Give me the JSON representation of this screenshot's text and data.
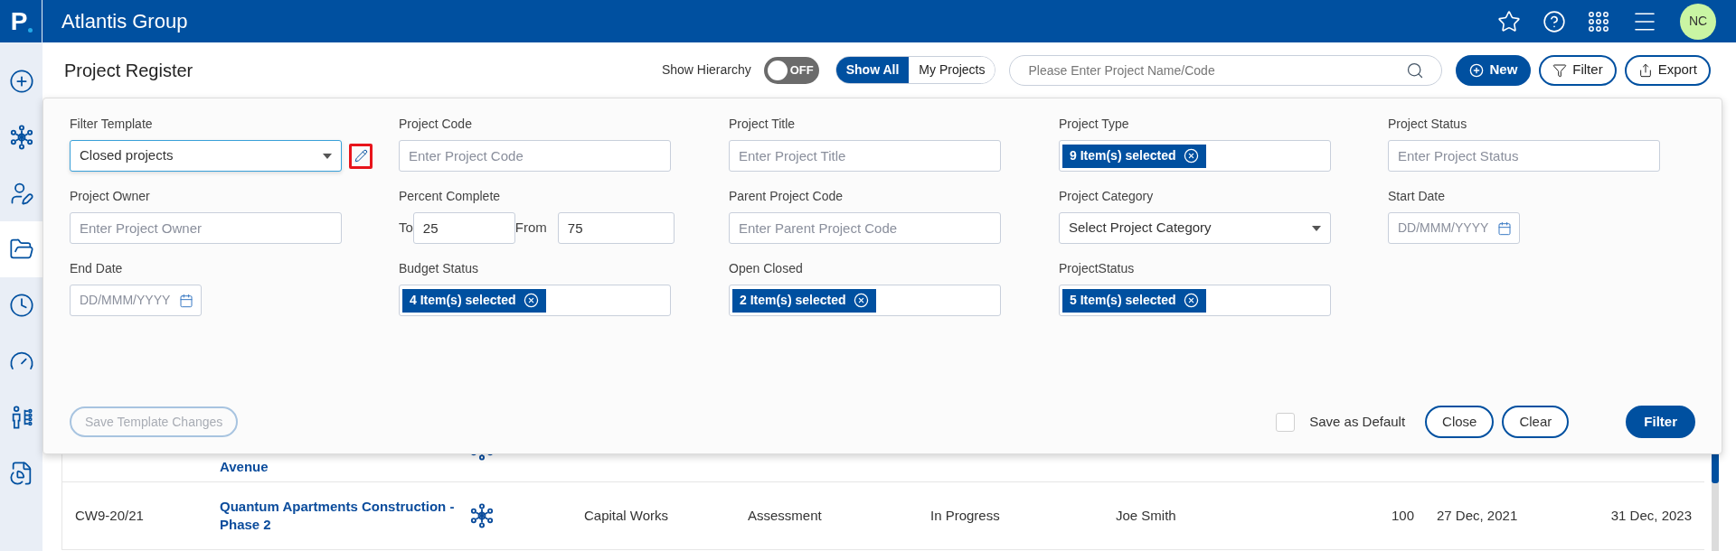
{
  "app_header": {
    "logo_text": "P",
    "company": "Atlantis Group",
    "avatar_initials": "NC"
  },
  "sidebar": {
    "items": [
      {
        "kind": "add",
        "selected": false
      },
      {
        "kind": "hub",
        "selected": false
      },
      {
        "kind": "user",
        "selected": false
      },
      {
        "kind": "folder",
        "selected": true
      },
      {
        "kind": "clock",
        "selected": false
      },
      {
        "kind": "gauge",
        "selected": false
      },
      {
        "kind": "org",
        "selected": false
      },
      {
        "kind": "report",
        "selected": false
      }
    ]
  },
  "page": {
    "title": "Project Register",
    "hierarchy": {
      "label": "Show Hierarchy",
      "on": false,
      "state_text": "OFF"
    },
    "view_tabs": [
      {
        "label": "Show All",
        "selected": true
      },
      {
        "label": "My Projects",
        "selected": false
      }
    ],
    "search": {
      "placeholder": "Please Enter Project Name/Code"
    },
    "buttons": [
      {
        "kind": "new",
        "label": "New"
      },
      {
        "kind": "filter",
        "label": "Filter"
      },
      {
        "kind": "export",
        "label": "Export"
      }
    ]
  },
  "filter_panel": {
    "fields": [
      {
        "kind": "template",
        "label": "Filter Template",
        "value": "Closed projects",
        "edit_highlighted": true
      },
      {
        "kind": "text",
        "label": "Project Code",
        "placeholder": "Enter Project Code"
      },
      {
        "kind": "text",
        "label": "Project Title",
        "placeholder": "Enter Project Title"
      },
      {
        "kind": "tags",
        "label": "Project Type",
        "tag": "9 Item(s) selected"
      },
      {
        "kind": "text",
        "label": "Project Status",
        "placeholder": "Enter Project Status"
      },
      {
        "kind": "text",
        "label": "Project Owner",
        "placeholder": "Enter Project Owner"
      },
      {
        "kind": "range",
        "label": "Percent Complete",
        "to_label": "To",
        "to_value": "25",
        "from_label": "From",
        "from_value": "75"
      },
      {
        "kind": "text",
        "label": "Parent Project Code",
        "placeholder": "Enter Parent Project Code"
      },
      {
        "kind": "select",
        "label": "Project Category",
        "placeholder": "Select Project Category"
      },
      {
        "kind": "date",
        "label": "Start Date",
        "placeholder": "DD/MMM/YYYY"
      },
      {
        "kind": "date",
        "label": "End Date",
        "placeholder": "DD/MMM/YYYY"
      },
      {
        "kind": "tags",
        "label": "Budget Status",
        "tag": "4 Item(s) selected"
      },
      {
        "kind": "tags",
        "label": "Open Closed",
        "tag": "2 Item(s) selected"
      },
      {
        "kind": "tags",
        "label": "ProjectStatus",
        "tag": "5 Item(s) selected"
      }
    ],
    "save_template": {
      "label": "Save Template Changes",
      "disabled": true
    },
    "save_default": {
      "label": "Save as Default",
      "checked": false
    },
    "buttons": [
      {
        "kind": "outline",
        "label": "Close"
      },
      {
        "kind": "outline",
        "label": "Clear"
      },
      {
        "kind": "primary",
        "label": "Filter"
      }
    ]
  },
  "table": {
    "rows": [
      {
        "title": "Avenue"
      },
      {
        "code": "CW9-20/21",
        "title": "Quantum Apartments Construction - Phase 2",
        "type": "Capital Works",
        "stage": "Assessment",
        "status": "In Progress",
        "owner": "Joe Smith",
        "percent": "100",
        "start": "27 Dec, 2021",
        "end": "31 Dec, 2023"
      }
    ]
  }
}
